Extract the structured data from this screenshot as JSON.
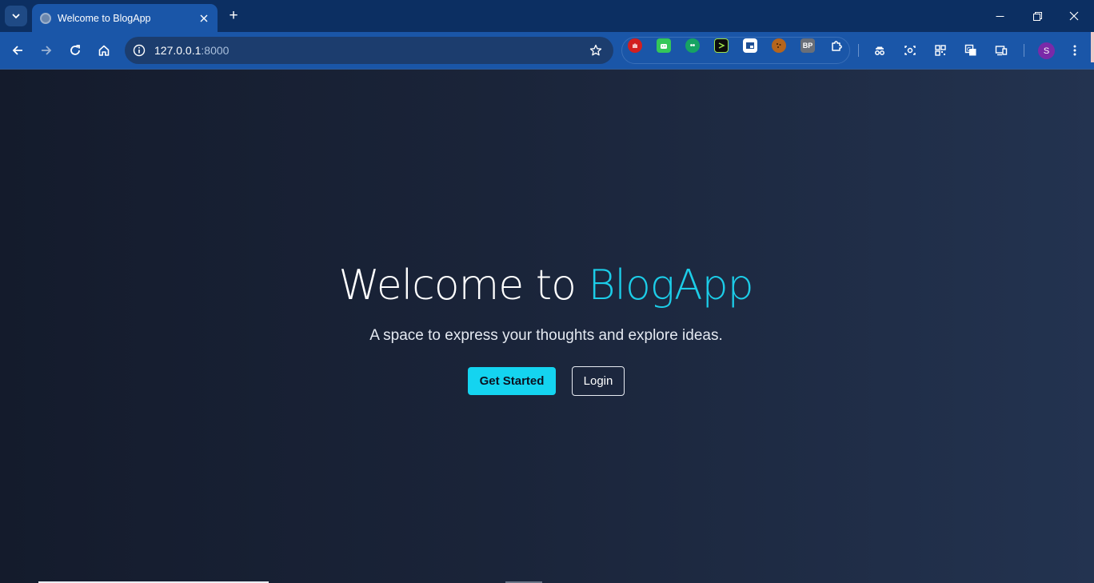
{
  "browser": {
    "tab": {
      "title": "Welcome to BlogApp"
    },
    "new_tab_label": "+",
    "address": {
      "host": "127.0.0.1",
      "port": ":8000"
    },
    "extensions": [
      "adblock-icon",
      "android-icon",
      "quote-icon",
      "terminal-icon",
      "screenshot-icon",
      "cookie-icon",
      "bp-icon",
      "puzzle-icon"
    ],
    "extension_bp_label": "BP",
    "profile_initial": "S",
    "colors": {
      "tab_strip": "#0c2f62",
      "toolbar": "#1a56a8",
      "omnibox": "#1c3d6e"
    }
  },
  "page": {
    "title_prefix": "Welcome to ",
    "title_accent": "BlogApp",
    "subtitle": "A space to express your thoughts and explore ideas.",
    "primary_button": "Get Started",
    "secondary_button": "Login",
    "colors": {
      "accent": "#1ccde8",
      "button_primary": "#14d4f0",
      "background_start": "#141b2c",
      "background_end": "#233350"
    }
  }
}
